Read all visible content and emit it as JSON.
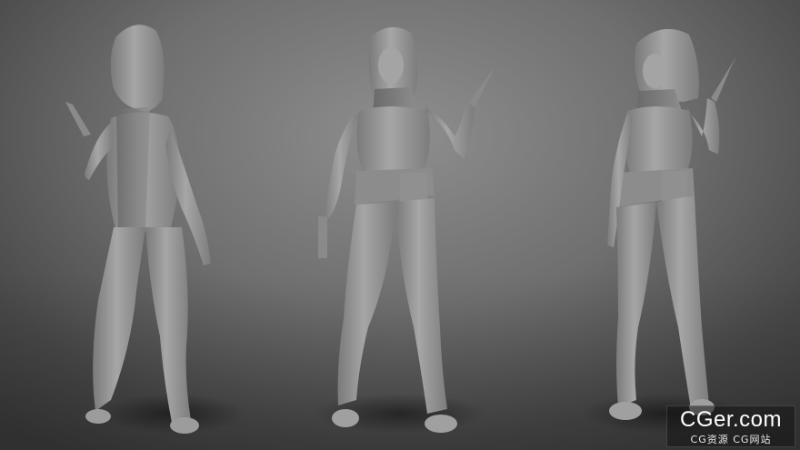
{
  "scene": {
    "figures": [
      {
        "name": "figure-back-view"
      },
      {
        "name": "figure-front-view"
      },
      {
        "name": "figure-three-quarter-view"
      }
    ]
  },
  "watermark": {
    "main": "CGer.com",
    "sub": "CG资源 CG网站"
  },
  "colors": {
    "clay": "#9a9a9a",
    "clay_shadow": "#6c6c6c",
    "background_center": "#8e8e8e",
    "background_edge": "#3a3a3a"
  }
}
